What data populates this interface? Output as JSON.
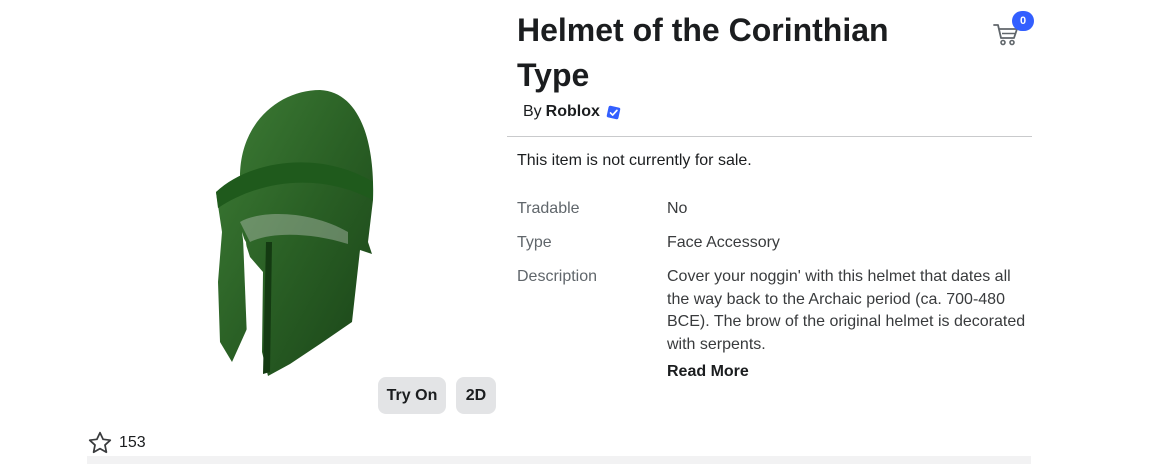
{
  "item": {
    "title": "Helmet of the Corinthian Type",
    "by_label": "By",
    "creator": "Roblox",
    "sale_status": "This item is not currently for sale."
  },
  "details": {
    "tradable_label": "Tradable",
    "tradable_value": "No",
    "type_label": "Type",
    "type_value": "Face Accessory",
    "description_label": "Description",
    "description_value": "Cover your noggin' with this helmet that dates all the way back to the Archaic period (ca. 700-480 BCE). The brow of the original helmet is decorated with serpents.",
    "read_more": "Read More"
  },
  "viewer": {
    "try_on": "Try On",
    "two_d": "2D"
  },
  "favorites": {
    "count": "153"
  },
  "cart": {
    "count": "0"
  },
  "icons": {
    "cart": "cart-icon",
    "favorite": "star-icon",
    "verified": "verified-badge-icon"
  },
  "colors": {
    "accent": "#335fff",
    "helmet": "#2f6b2b"
  }
}
